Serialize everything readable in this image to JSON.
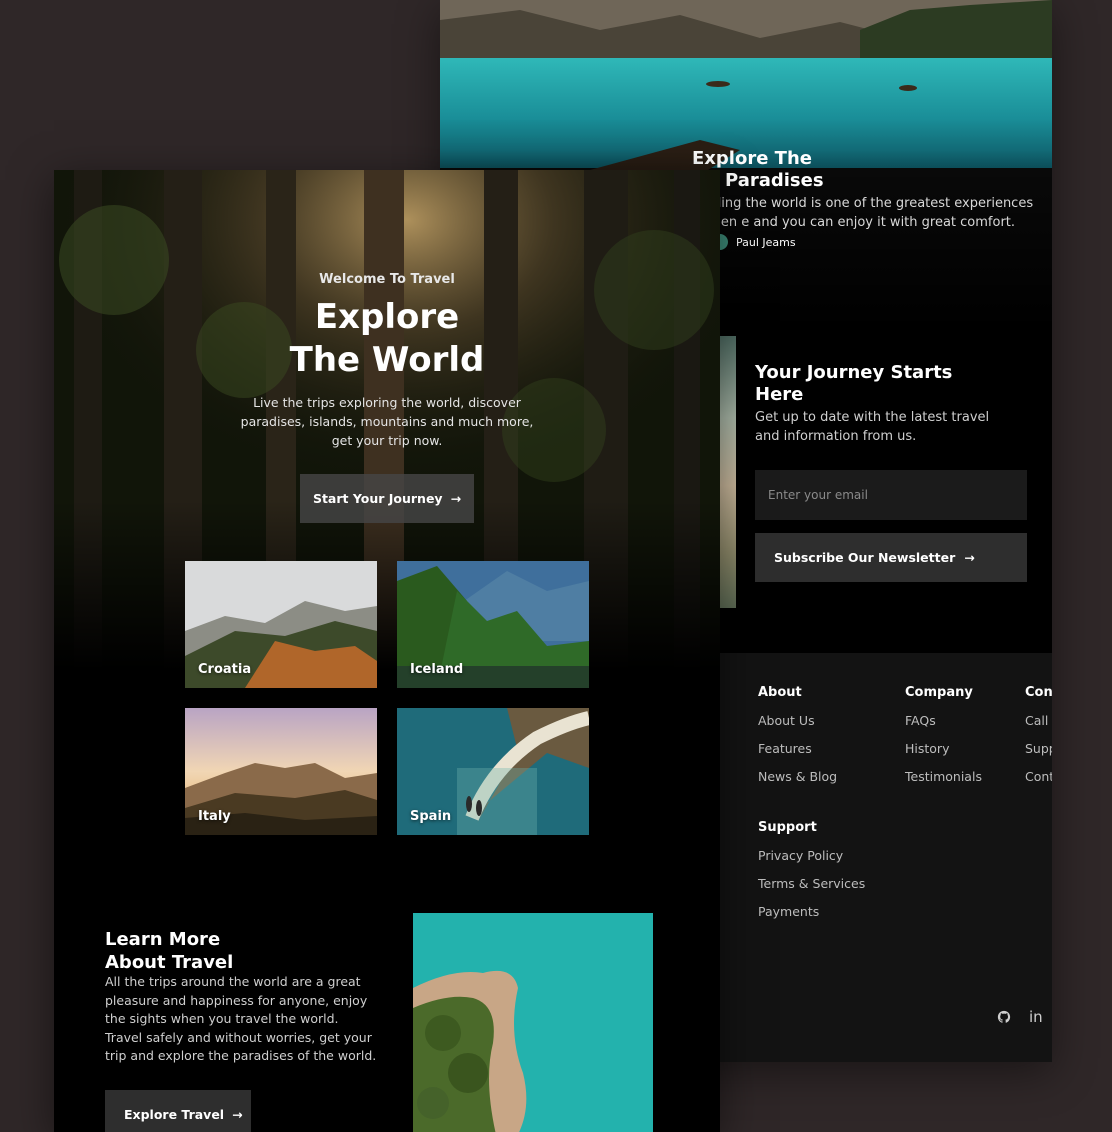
{
  "back_page": {
    "hero": {
      "title_line1": "Explore The",
      "title_line2": "Paradises",
      "description": "veling the world is one of the greatest experiences when e and you can enjoy it with great comfort.",
      "author": "Paul Jeams"
    },
    "newsletter": {
      "title": "Your Journey Starts Here",
      "subtitle": "Get up to date with the latest travel and information from us.",
      "email_placeholder": "Enter your email",
      "button_label": "Subscribe Our Newsletter",
      "button_icon": "arrow-right-icon"
    },
    "footer": {
      "about": {
        "heading": "About",
        "links": [
          "About Us",
          "Features",
          "News & Blog"
        ]
      },
      "company": {
        "heading": "Company",
        "links": [
          "FAQs",
          "History",
          "Testimonials"
        ]
      },
      "contact": {
        "heading": "Con",
        "links": [
          "Call",
          "Supp",
          "Cont"
        ]
      },
      "support": {
        "heading": "Support",
        "links": [
          "Privacy Policy",
          "Terms & Services",
          "Payments"
        ]
      },
      "social": {
        "github_icon": "github-icon",
        "linkedin_label": "in"
      }
    }
  },
  "front_page": {
    "hero": {
      "welcome": "Welcome To Travel",
      "title_line1": "Explore",
      "title_line2": "The World",
      "subtitle": "Live the trips exploring the world, discover paradises, islands, mountains and much more, get your trip now.",
      "cta_label": "Start Your Journey",
      "cta_icon": "arrow-right-icon"
    },
    "destinations": [
      {
        "name": "Croatia"
      },
      {
        "name": "Iceland"
      },
      {
        "name": "Italy"
      },
      {
        "name": "Spain"
      }
    ],
    "learn_more": {
      "title_line1": "Learn More",
      "title_line2": "About Travel",
      "description": "All the trips around the world are a great pleasure and happiness for anyone, enjoy the sights when you travel the world. Travel safely and without worries, get your trip and explore the paradises of the world.",
      "button_label": "Explore Travel",
      "button_icon": "arrow-right-icon"
    }
  },
  "colors": {
    "background": "#2f2728",
    "card": "#000000",
    "footer": "#131313",
    "button": "#2e2e2e",
    "input": "#1b1b1b",
    "lake": "#1fa3a8"
  }
}
